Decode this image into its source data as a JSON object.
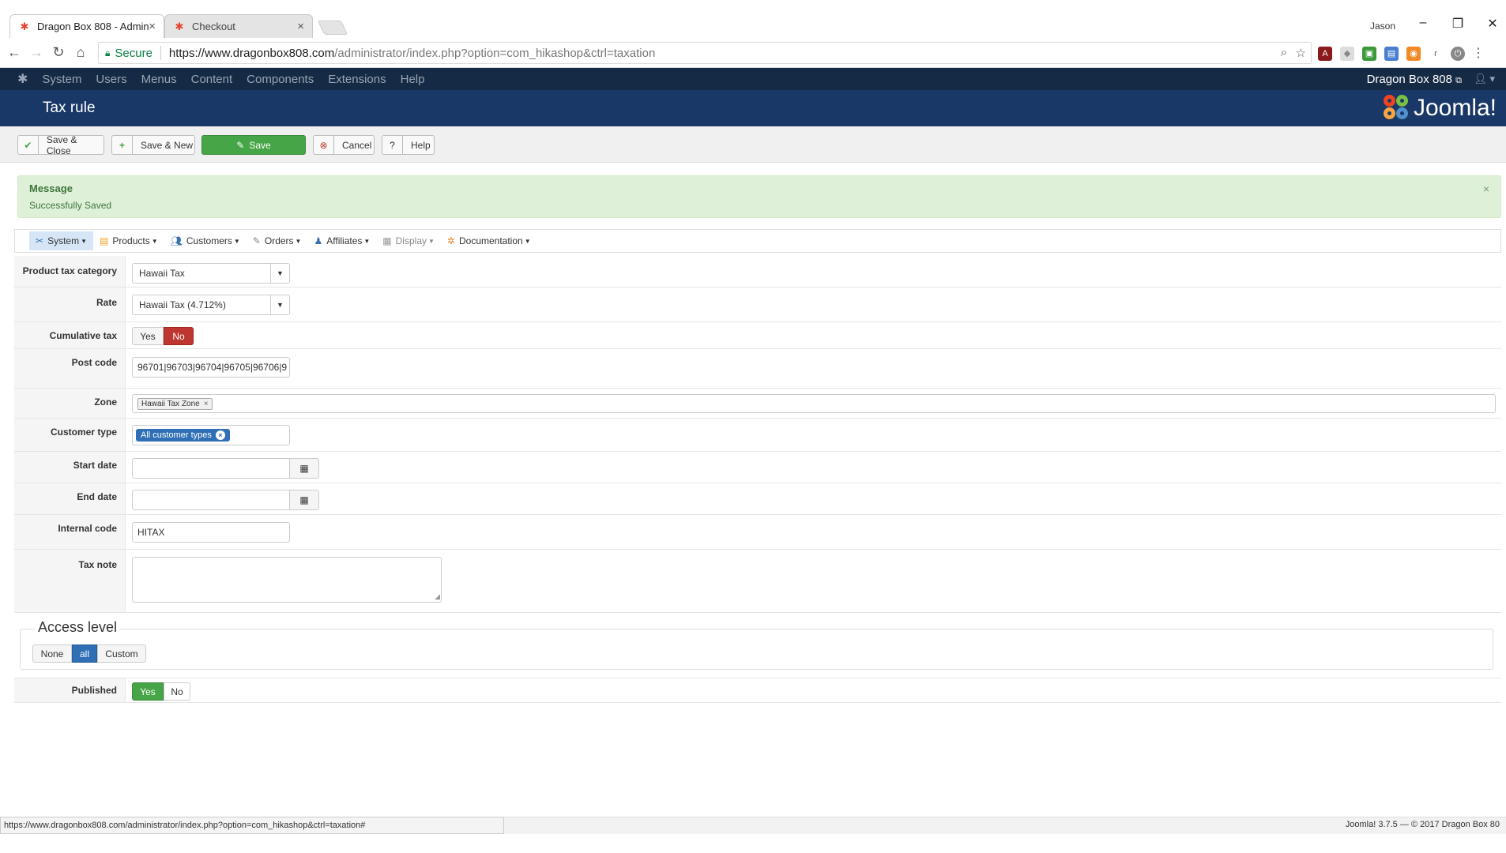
{
  "browser": {
    "tabs": [
      {
        "title": "Dragon Box 808 - Admin"
      },
      {
        "title": "Checkout"
      }
    ],
    "user": "Jason",
    "secure_label": "Secure",
    "url_host": "https://www.dragonbox808.com",
    "url_path": "/administrator/index.php?option=com_hikashop&ctrl=taxation",
    "status_url": "https://www.dragonbox808.com/administrator/index.php?option=com_hikashop&ctrl=taxation#"
  },
  "joomla_nav": {
    "items": [
      "System",
      "Users",
      "Menus",
      "Content",
      "Components",
      "Extensions",
      "Help"
    ],
    "site_name": "Dragon Box 808"
  },
  "header": {
    "title": "Tax rule",
    "brand": "Joomla!"
  },
  "toolbar": {
    "save_close": "Save & Close",
    "save_new": "Save & New",
    "save": "Save",
    "cancel": "Cancel",
    "help": "Help"
  },
  "message": {
    "heading": "Message",
    "body": "Successfully Saved"
  },
  "hika_menu": [
    "System",
    "Products",
    "Customers",
    "Orders",
    "Affiliates",
    "Display",
    "Documentation"
  ],
  "form": {
    "product_tax_category": {
      "label": "Product tax category",
      "value": "Hawaii Tax"
    },
    "rate": {
      "label": "Rate",
      "value": "Hawaii Tax (4.712%)"
    },
    "cumulative_tax": {
      "label": "Cumulative tax",
      "yes": "Yes",
      "no": "No",
      "selected": "No"
    },
    "post_code": {
      "label": "Post code",
      "value": "96701|96703|96704|96705|96706|9"
    },
    "zone": {
      "label": "Zone",
      "chip": "Hawaii Tax Zone"
    },
    "customer_type": {
      "label": "Customer type",
      "chip": "All customer types"
    },
    "start_date": {
      "label": "Start date",
      "value": ""
    },
    "end_date": {
      "label": "End date",
      "value": ""
    },
    "internal_code": {
      "label": "Internal code",
      "value": "HITAX"
    },
    "tax_note": {
      "label": "Tax note",
      "value": ""
    },
    "access_level": {
      "legend": "Access level",
      "none": "None",
      "all": "all",
      "custom": "Custom",
      "selected": "all"
    },
    "published": {
      "label": "Published",
      "yes": "Yes",
      "no": "No",
      "selected": "Yes"
    }
  },
  "footer": {
    "version": "Joomla! 3.7.5",
    "copyright": "— © 2017 Dragon Box 80"
  }
}
